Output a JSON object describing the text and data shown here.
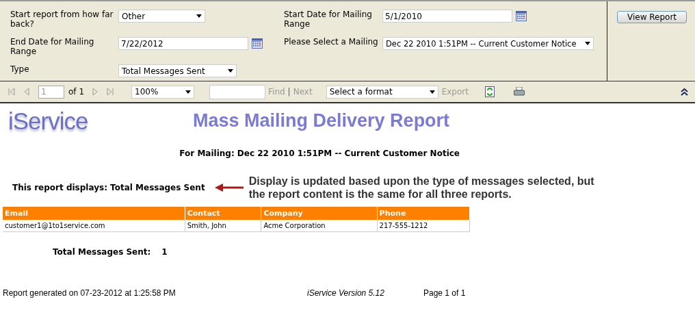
{
  "parameters": {
    "left": [
      {
        "kind": "select",
        "label": "Start report from how far back?",
        "value": "Other"
      },
      {
        "kind": "date",
        "label": "End Date for Mailing Range",
        "value": "7/22/2012"
      },
      {
        "kind": "select",
        "label": "Type",
        "value": "Total Messages Sent"
      }
    ],
    "right": [
      {
        "kind": "date",
        "label": "Start Date for Mailing Range",
        "value": "5/1/2010"
      },
      {
        "kind": "select",
        "label": "Please Select a Mailing",
        "value": "Dec 22 2010  1:51PM -- Current Customer Notice"
      }
    ],
    "view_button": "View Report"
  },
  "toolbar": {
    "page": "1",
    "of": "of 1",
    "zoom": "100%",
    "find": "Find",
    "separator": "|",
    "next": "Next",
    "format": "Select a format",
    "export": "Export"
  },
  "report": {
    "logo": "iService",
    "title": "Mass Mailing Delivery Report",
    "subtitle": "For Mailing: Dec 22 2010 1:51PM -- Current Customer Notice",
    "displays": "This report displays: Total Messages Sent",
    "annotation": "Display is updated based upon the type of messages selected, but the report content is the same for all three reports.",
    "table": {
      "columns": [
        "Email",
        "Contact",
        "Company",
        "Phone"
      ],
      "rows": [
        [
          "customer1@1to1service.com",
          "Smith, John",
          "Acme Corporation",
          "217-555-1212"
        ]
      ]
    },
    "total_label": "Total Messages Sent:",
    "total_value": "1",
    "footer": {
      "generated": "Report generated on 07-23-2012 at 1:25:58 PM",
      "version": "iService Version 5.12",
      "page": "Page 1 of 1"
    }
  }
}
